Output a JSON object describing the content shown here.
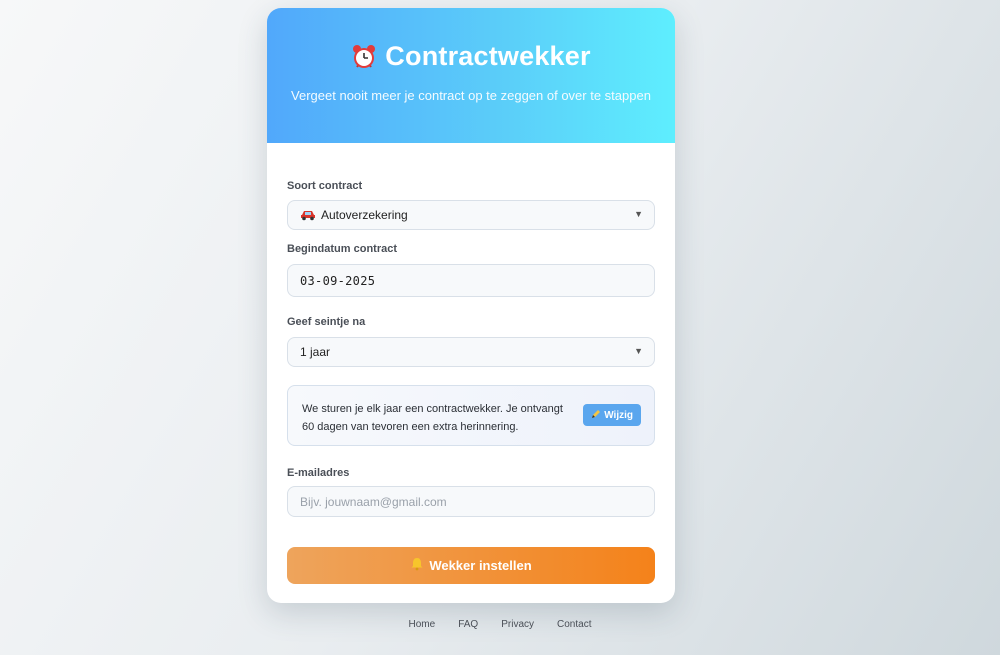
{
  "header": {
    "title": "Contractwekker",
    "subtitle": "Vergeet nooit meer je contract op te zeggen of over te stappen",
    "icon": "alarm-clock-icon"
  },
  "form": {
    "contract_type": {
      "label": "Soort contract",
      "value": "Autoverzekering",
      "icon": "car-icon"
    },
    "start_date": {
      "label": "Begindatum contract",
      "value": "03-09-2025"
    },
    "reminder": {
      "label": "Geef seintje na",
      "value": "1 jaar"
    },
    "info": {
      "text": "We sturen je elk jaar een contractwekker. Je ontvangt 60 dagen van tevoren een extra herinnering.",
      "edit_label": "Wijzig"
    },
    "email": {
      "label": "E-mailadres",
      "placeholder": "Bijv. jouwnaam@gmail.com"
    },
    "submit_label": "Wekker instellen"
  },
  "footer": {
    "links": [
      "Home",
      "FAQ",
      "Privacy",
      "Contact"
    ]
  },
  "colors": {
    "header_gradient_start": "#51a8fb",
    "header_gradient_end": "#5eeefe",
    "submit_gradient_start": "#eea45c",
    "submit_gradient_end": "#f4821a",
    "edit_button": "#5aa6ee"
  }
}
